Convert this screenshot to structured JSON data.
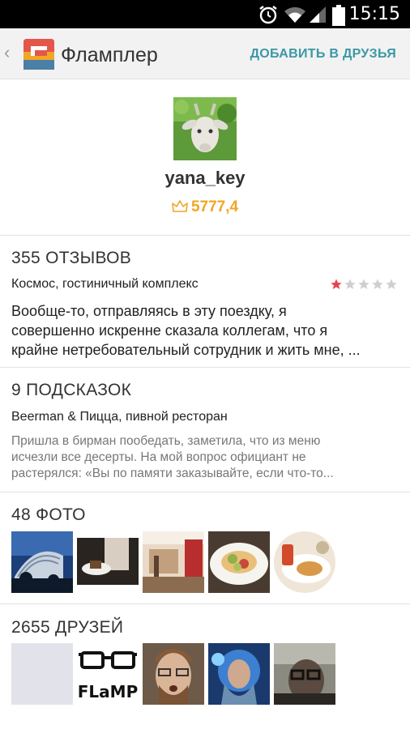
{
  "status_bar": {
    "time": "15:15"
  },
  "app_bar": {
    "back_icon": "‹",
    "title": "Фламплер",
    "add_friend": "ДОБАВИТЬ В ДРУЗЬЯ"
  },
  "profile": {
    "username": "yana_key",
    "rating": "5777,4"
  },
  "reviews": {
    "title": "355 ОТЗЫВОВ",
    "place": "Космос, гостиничный комплекс",
    "stars": 1,
    "text_line1": "Вообще-то, отправляясь в эту поездку, я",
    "text_line2": "совершенно искренне сказала коллегам, что я",
    "text_line3": "крайне нетребовательный сотрудник и жить мне, ..."
  },
  "tips": {
    "title": "9 ПОДСКАЗОК",
    "place": "Beerman & Пицца, пивной ресторан",
    "text_line1": "Пришла в бирман пообедать, заметила, что из меню",
    "text_line2": "исчезли все десерты. На мой вопрос официант не",
    "text_line3": "растерялся: «Вы по памяти заказывайте, если что-то..."
  },
  "photos": {
    "title": "48 ФОТО"
  },
  "friends": {
    "title": "2655 ДРУЗЕЙ",
    "flamp_label": "FLaMP"
  },
  "colors": {
    "accent": "#3a98a6",
    "rating": "#f0a626",
    "star_active": "#e8444a",
    "star_inactive": "#cfcfcf"
  }
}
